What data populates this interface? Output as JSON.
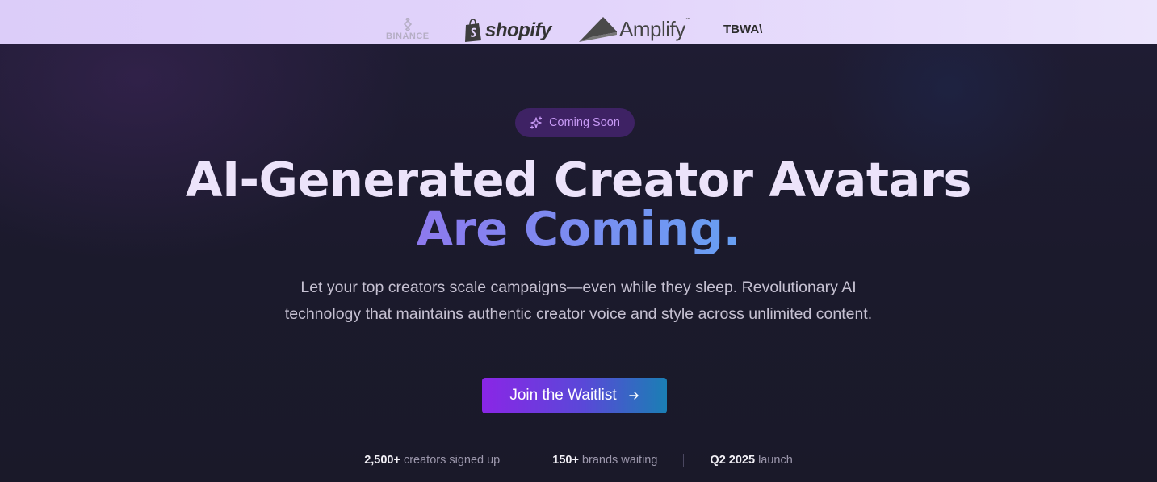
{
  "logos": [
    {
      "name": "binance",
      "text": "BINANCE"
    },
    {
      "name": "shopify",
      "text": "shopify"
    },
    {
      "name": "amplify",
      "text": "Amplify",
      "mark": "™"
    },
    {
      "name": "tbwa",
      "text": "TBWA\\"
    }
  ],
  "badge": {
    "label": "Coming Soon",
    "icon": "sparkle-icon"
  },
  "headline": {
    "line1": "AI-Generated Creator Avatars",
    "line2": "Are Coming."
  },
  "subtitle": "Let your top creators scale campaigns—even while they sleep. Revolutionary AI technology that maintains authentic creator voice and style across unlimited content.",
  "cta": {
    "label": "Join the Waitlist",
    "icon": "arrow-right-icon"
  },
  "stats": [
    {
      "value": "2,500+",
      "label": "creators signed up"
    },
    {
      "value": "150+",
      "label": "brands waiting"
    },
    {
      "value": "Q2 2025",
      "label": "launch"
    }
  ],
  "colors": {
    "accent_purple": "#8a26e6",
    "accent_cyan": "#1ec7ec",
    "badge_bg": "#3e2264",
    "badge_text": "#c89af6",
    "hero_bg": "#1b1a2c"
  }
}
